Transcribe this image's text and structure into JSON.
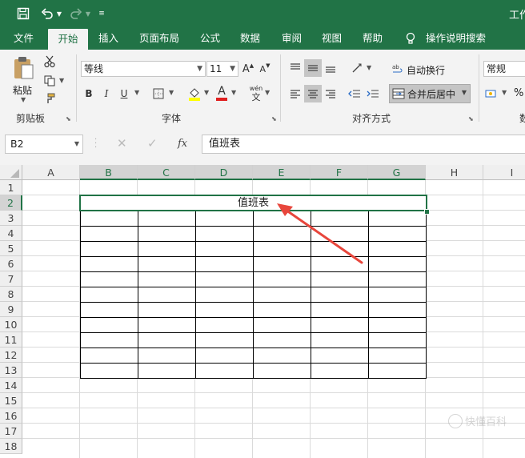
{
  "titlebar": {
    "app_title": "工作"
  },
  "tabs": [
    "文件",
    "开始",
    "插入",
    "页面布局",
    "公式",
    "数据",
    "审阅",
    "视图",
    "帮助",
    "操作说明搜索"
  ],
  "ribbon": {
    "clipboard": {
      "paste_label": "粘贴",
      "group_label": "剪贴板"
    },
    "font": {
      "font_name": "等线",
      "font_size": "11",
      "group_label": "字体",
      "bold": "B",
      "italic": "I",
      "underline": "U",
      "increase": "A",
      "decrease": "A",
      "fill_letter": "A",
      "phonetic_top": "wén",
      "phonetic_bottom": "文"
    },
    "alignment": {
      "wrap_text": "自动换行",
      "merge_center": "合并后居中",
      "group_label": "对齐方式"
    },
    "number": {
      "format": "常规",
      "percent": "%",
      "group_label": "数"
    }
  },
  "formula_bar": {
    "name_box": "B2",
    "fx": "fx",
    "content": "值班表"
  },
  "sheet": {
    "columns": [
      "A",
      "B",
      "C",
      "D",
      "E",
      "F",
      "G",
      "H",
      "I"
    ],
    "rows": [
      "1",
      "2",
      "3",
      "4",
      "5",
      "6",
      "7",
      "8",
      "9",
      "10",
      "11",
      "12",
      "13",
      "14",
      "15",
      "16",
      "17",
      "18"
    ],
    "merged_cell_text": "值班表",
    "selected_cell": "B2"
  },
  "watermark": "快懂百科",
  "colors": {
    "accent": "#217346",
    "arrow": "#e8463c"
  }
}
